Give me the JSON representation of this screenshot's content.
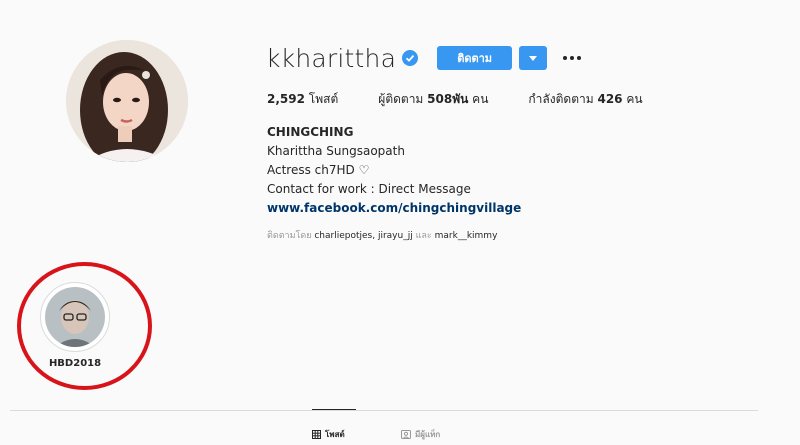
{
  "profile": {
    "username": "kkharittha",
    "verified": true,
    "follow_label": "ติดตาม",
    "stats": {
      "posts_value": "2,592",
      "posts_label": "โพสต์",
      "followers_label": "ผู้ติดตาม",
      "followers_value": "508พัน",
      "followers_unit": "คน",
      "following_label": "กำลังติดตาม",
      "following_value": "426",
      "following_unit": "คน"
    },
    "bio": {
      "display_name": "CHINGCHING",
      "full_name": "Kharittha Sungsaopath",
      "line1": "Actress ch7HD ♡",
      "line2": "Contact for work : Direct Message",
      "link": "www.facebook.com/chingchingvillage"
    },
    "followed_by": {
      "prefix": "ติดตามโดย",
      "users": "charliepotjes, jirayu_jj",
      "conjunction": "และ",
      "last_user": "mark__kimmy"
    }
  },
  "highlights": [
    {
      "label": "HBD2018"
    }
  ],
  "tabs": {
    "posts": "โพสต์",
    "tagged": "มีผู้แท็ก"
  },
  "colors": {
    "accent": "#3897f0",
    "annotation": "#d8141b",
    "link": "#003569",
    "background": "#fafafa"
  },
  "icons": {
    "verified": "verified-badge-icon",
    "more": "more-options-icon",
    "posts_tab": "grid-icon",
    "tagged_tab": "tagged-photo-icon"
  }
}
